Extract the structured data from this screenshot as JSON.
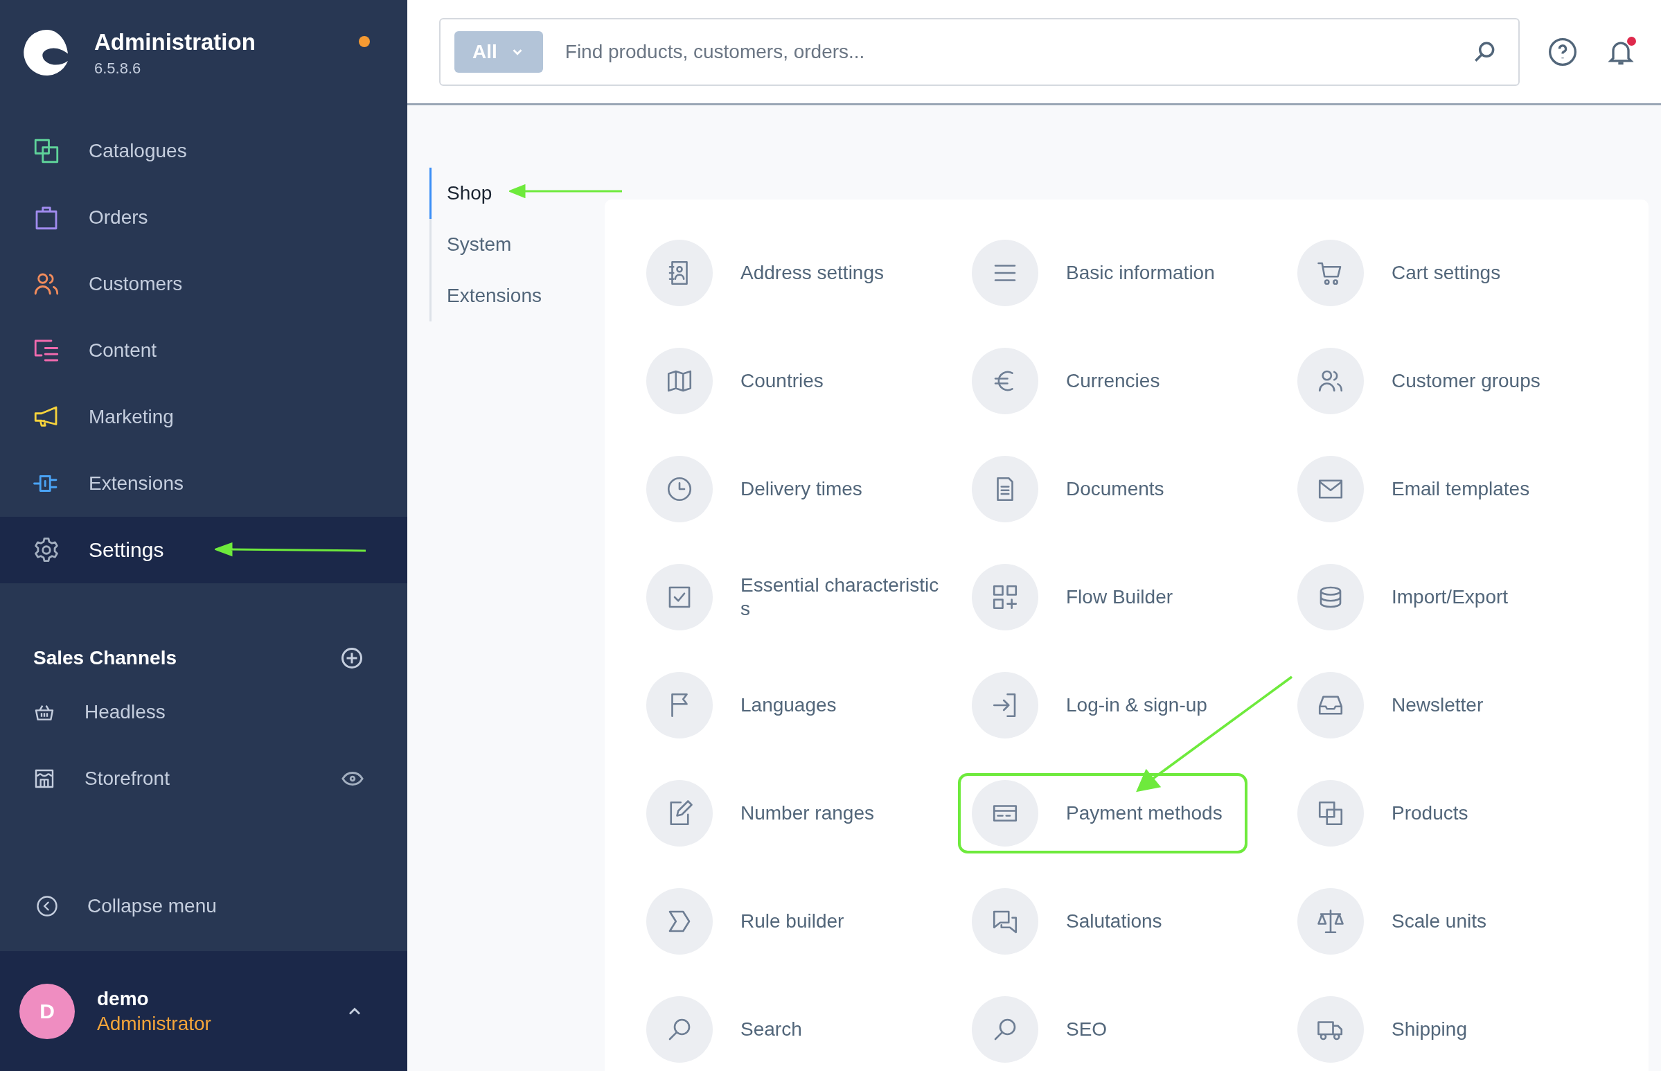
{
  "sidebar": {
    "title": "Administration",
    "version": "6.5.8.6",
    "update_dot": true,
    "items": [
      {
        "label": "Catalogues",
        "color": "#5fd39a",
        "selected": false,
        "highlighted": false
      },
      {
        "label": "Orders",
        "color": "#a18cf0",
        "selected": false,
        "highlighted": false
      },
      {
        "label": "Customers",
        "color": "#f28c5c",
        "selected": false,
        "highlighted": false
      },
      {
        "label": "Content",
        "color": "#f06aae",
        "selected": false,
        "highlighted": false
      },
      {
        "label": "Marketing",
        "color": "#f7d33c",
        "selected": false,
        "highlighted": false
      },
      {
        "label": "Extensions",
        "color": "#4aa3f5",
        "selected": false,
        "highlighted": false
      },
      {
        "label": "Settings",
        "color": "#a3afc0",
        "selected": true,
        "highlighted": true
      }
    ],
    "sales_channels": {
      "title": "Sales Channels",
      "items": [
        {
          "label": "Headless",
          "eye": false
        },
        {
          "label": "Storefront",
          "eye": true
        }
      ]
    },
    "collapse": "Collapse menu",
    "user": {
      "initial": "D",
      "name": "demo",
      "role": "Administrator"
    }
  },
  "topbar": {
    "filter": "All",
    "placeholder": "Find products, customers, orders...",
    "notification": true
  },
  "tabs": [
    {
      "label": "Shop",
      "selected": true,
      "highlighted": true
    },
    {
      "label": "System",
      "selected": false,
      "highlighted": false
    },
    {
      "label": "Extensions",
      "selected": false,
      "highlighted": false
    }
  ],
  "settings": [
    {
      "label": "Address settings",
      "highlighted": false
    },
    {
      "label": "Basic information",
      "highlighted": false
    },
    {
      "label": "Cart settings",
      "highlighted": false
    },
    {
      "label": "Countries",
      "highlighted": false
    },
    {
      "label": "Currencies",
      "highlighted": false
    },
    {
      "label": "Customer groups",
      "highlighted": false
    },
    {
      "label": "Delivery times",
      "highlighted": false
    },
    {
      "label": "Documents",
      "highlighted": false
    },
    {
      "label": "Email templates",
      "highlighted": false
    },
    {
      "label": "Essential characteristics",
      "highlighted": false
    },
    {
      "label": "Flow Builder",
      "highlighted": false
    },
    {
      "label": "Import/Export",
      "highlighted": false
    },
    {
      "label": "Languages",
      "highlighted": false
    },
    {
      "label": "Log-in & sign-up",
      "highlighted": false
    },
    {
      "label": "Newsletter",
      "highlighted": false
    },
    {
      "label": "Number ranges",
      "highlighted": false
    },
    {
      "label": "Payment methods",
      "highlighted": true
    },
    {
      "label": "Products",
      "highlighted": false
    },
    {
      "label": "Rule builder",
      "highlighted": false
    },
    {
      "label": "Salutations",
      "highlighted": false
    },
    {
      "label": "Scale units",
      "highlighted": false
    },
    {
      "label": "Search",
      "highlighted": false
    },
    {
      "label": "SEO",
      "highlighted": false
    },
    {
      "label": "Shipping",
      "highlighted": false
    }
  ]
}
